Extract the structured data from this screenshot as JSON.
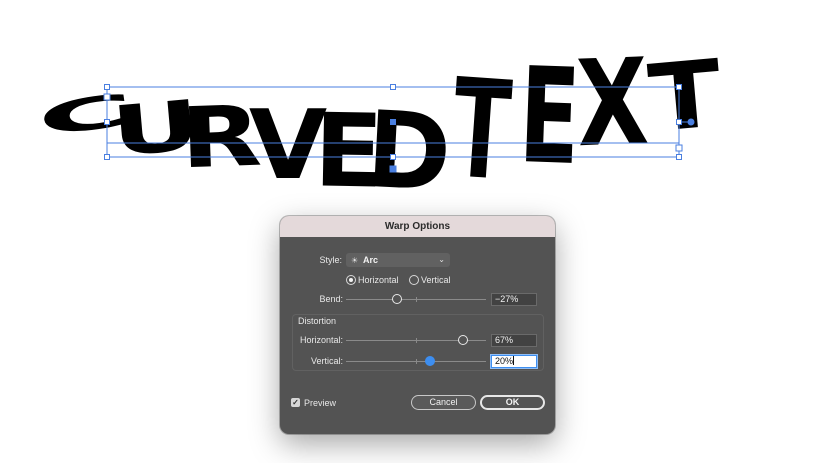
{
  "artwork": {
    "text": "CURVED TEXT"
  },
  "dialog": {
    "title": "Warp Options",
    "style": {
      "label": "Style:",
      "value": "Arc",
      "icon": "arc-warp-icon"
    },
    "orientation": {
      "options": [
        {
          "label": "Horizontal",
          "selected": true
        },
        {
          "label": "Vertical",
          "selected": false
        }
      ]
    },
    "bend": {
      "label": "Bend:",
      "value": "−27%",
      "percent": -27
    },
    "distortion": {
      "title": "Distortion",
      "horizontal": {
        "label": "Horizontal:",
        "value": "67%",
        "percent": 67
      },
      "vertical": {
        "label": "Vertical:",
        "value": "20%",
        "percent": 20
      }
    },
    "preview": {
      "label": "Preview",
      "checked": true
    },
    "cancel_label": "Cancel",
    "ok_label": "OK"
  },
  "colors": {
    "selection": "#4a7fe0",
    "dialog_bg": "#535353",
    "titlebar": "#e4d9da",
    "accent": "#3d8ef0"
  }
}
